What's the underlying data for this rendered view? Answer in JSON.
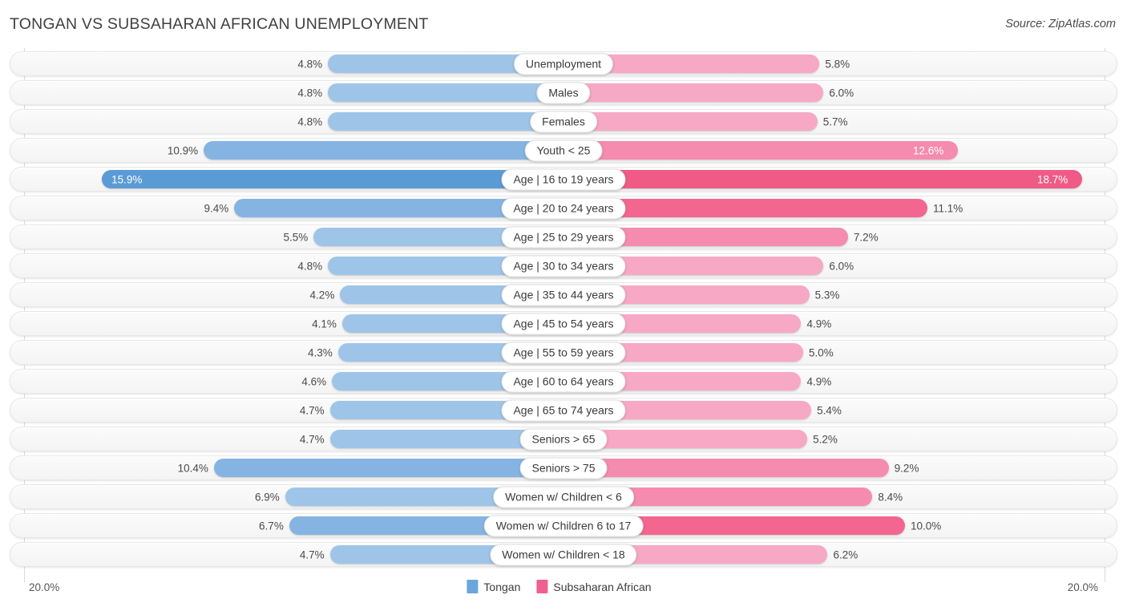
{
  "header": {
    "title": "TONGAN VS SUBSAHARAN AFRICAN UNEMPLOYMENT",
    "source": "Source: ZipAtlas.com"
  },
  "axis": {
    "left_label": "20.0%",
    "right_label": "20.0%"
  },
  "legend": {
    "items": [
      {
        "label": "Tongan",
        "color": "#6aa6dd"
      },
      {
        "label": "Subsaharan African",
        "color": "#f0608f"
      }
    ]
  },
  "colors": {
    "blue_light": "#9ec5e8",
    "blue_mid": "#85b4e2",
    "blue_dark": "#5b9bd5",
    "pink_light": "#f7a8c4",
    "pink_mid": "#f58bae",
    "pink_dark": "#f2668f",
    "pink_deepest": "#ef5a86",
    "track": "#f6f6f6",
    "gridline": "#d9d9d9"
  },
  "chart_data": {
    "type": "bar",
    "subtype": "diverging-bidirectional",
    "title": "TONGAN VS SUBSAHARAN AFRICAN UNEMPLOYMENT",
    "xlabel": "",
    "ylabel": "",
    "xlim": [
      20.0,
      20.0
    ],
    "axis_left_max": 20.0,
    "axis_right_max": 20.0,
    "grid": true,
    "legend_position": "bottom-center",
    "unit": "%",
    "categories": [
      "Unemployment",
      "Males",
      "Females",
      "Youth < 25",
      "Age | 16 to 19 years",
      "Age | 20 to 24 years",
      "Age | 25 to 29 years",
      "Age | 30 to 34 years",
      "Age | 35 to 44 years",
      "Age | 45 to 54 years",
      "Age | 55 to 59 years",
      "Age | 60 to 64 years",
      "Age | 65 to 74 years",
      "Seniors > 65",
      "Seniors > 75",
      "Women w/ Children < 6",
      "Women w/ Children 6 to 17",
      "Women w/ Children < 18"
    ],
    "series": [
      {
        "name": "Tongan",
        "color": "#6aa6dd",
        "values": [
          4.8,
          4.8,
          4.8,
          10.9,
          15.9,
          9.4,
          5.5,
          4.8,
          4.2,
          4.1,
          4.3,
          4.6,
          4.7,
          4.7,
          10.4,
          6.9,
          6.7,
          4.7
        ]
      },
      {
        "name": "Subsaharan African",
        "color": "#f0608f",
        "values": [
          5.8,
          6.0,
          5.7,
          12.6,
          18.7,
          11.1,
          7.2,
          6.0,
          5.3,
          4.9,
          5.0,
          4.9,
          5.4,
          5.2,
          9.2,
          8.4,
          10.0,
          6.2
        ]
      }
    ]
  },
  "rows": [
    {
      "label": "Unemployment",
      "left": "4.8%",
      "right": "5.8%",
      "lv": 4.8,
      "rv": 5.8,
      "lshade": "light",
      "rshade": "light",
      "lin": false,
      "rin": false
    },
    {
      "label": "Males",
      "left": "4.8%",
      "right": "6.0%",
      "lv": 4.8,
      "rv": 6.0,
      "lshade": "light",
      "rshade": "light",
      "lin": false,
      "rin": false
    },
    {
      "label": "Females",
      "left": "4.8%",
      "right": "5.7%",
      "lv": 4.8,
      "rv": 5.7,
      "lshade": "light",
      "rshade": "light",
      "lin": false,
      "rin": false
    },
    {
      "label": "Youth < 25",
      "left": "10.9%",
      "right": "12.6%",
      "lv": 10.9,
      "rv": 12.6,
      "lshade": "mid",
      "rshade": "mid",
      "lin": false,
      "rin": true
    },
    {
      "label": "Age | 16 to 19 years",
      "left": "15.9%",
      "right": "18.7%",
      "lv": 15.9,
      "rv": 18.7,
      "lshade": "dark",
      "rshade": "deepest",
      "lin": true,
      "rin": true
    },
    {
      "label": "Age | 20 to 24 years",
      "left": "9.4%",
      "right": "11.1%",
      "lv": 9.4,
      "rv": 11.1,
      "lshade": "mid",
      "rshade": "dark",
      "lin": false,
      "rin": false
    },
    {
      "label": "Age | 25 to 29 years",
      "left": "5.5%",
      "right": "7.2%",
      "lv": 5.5,
      "rv": 7.2,
      "lshade": "light",
      "rshade": "mid",
      "lin": false,
      "rin": false
    },
    {
      "label": "Age | 30 to 34 years",
      "left": "4.8%",
      "right": "6.0%",
      "lv": 4.8,
      "rv": 6.0,
      "lshade": "light",
      "rshade": "light",
      "lin": false,
      "rin": false
    },
    {
      "label": "Age | 35 to 44 years",
      "left": "4.2%",
      "right": "5.3%",
      "lv": 4.2,
      "rv": 5.3,
      "lshade": "light",
      "rshade": "light",
      "lin": false,
      "rin": false
    },
    {
      "label": "Age | 45 to 54 years",
      "left": "4.1%",
      "right": "4.9%",
      "lv": 4.1,
      "rv": 4.9,
      "lshade": "light",
      "rshade": "light",
      "lin": false,
      "rin": false
    },
    {
      "label": "Age | 55 to 59 years",
      "left": "4.3%",
      "right": "5.0%",
      "lv": 4.3,
      "rv": 5.0,
      "lshade": "light",
      "rshade": "light",
      "lin": false,
      "rin": false
    },
    {
      "label": "Age | 60 to 64 years",
      "left": "4.6%",
      "right": "4.9%",
      "lv": 4.6,
      "rv": 4.9,
      "lshade": "light",
      "rshade": "light",
      "lin": false,
      "rin": false
    },
    {
      "label": "Age | 65 to 74 years",
      "left": "4.7%",
      "right": "5.4%",
      "lv": 4.7,
      "rv": 5.4,
      "lshade": "light",
      "rshade": "light",
      "lin": false,
      "rin": false
    },
    {
      "label": "Seniors > 65",
      "left": "4.7%",
      "right": "5.2%",
      "lv": 4.7,
      "rv": 5.2,
      "lshade": "light",
      "rshade": "light",
      "lin": false,
      "rin": false
    },
    {
      "label": "Seniors > 75",
      "left": "10.4%",
      "right": "9.2%",
      "lv": 10.4,
      "rv": 9.2,
      "lshade": "mid",
      "rshade": "mid",
      "lin": false,
      "rin": false
    },
    {
      "label": "Women w/ Children < 6",
      "left": "6.9%",
      "right": "8.4%",
      "lv": 6.9,
      "rv": 8.4,
      "lshade": "light",
      "rshade": "mid",
      "lin": false,
      "rin": false
    },
    {
      "label": "Women w/ Children 6 to 17",
      "left": "6.7%",
      "right": "10.0%",
      "lv": 6.7,
      "rv": 10.0,
      "lshade": "mid",
      "rshade": "dark",
      "lin": false,
      "rin": false
    },
    {
      "label": "Women w/ Children < 18",
      "left": "4.7%",
      "right": "6.2%",
      "lv": 4.7,
      "rv": 6.2,
      "lshade": "light",
      "rshade": "light",
      "lin": false,
      "rin": false
    }
  ]
}
